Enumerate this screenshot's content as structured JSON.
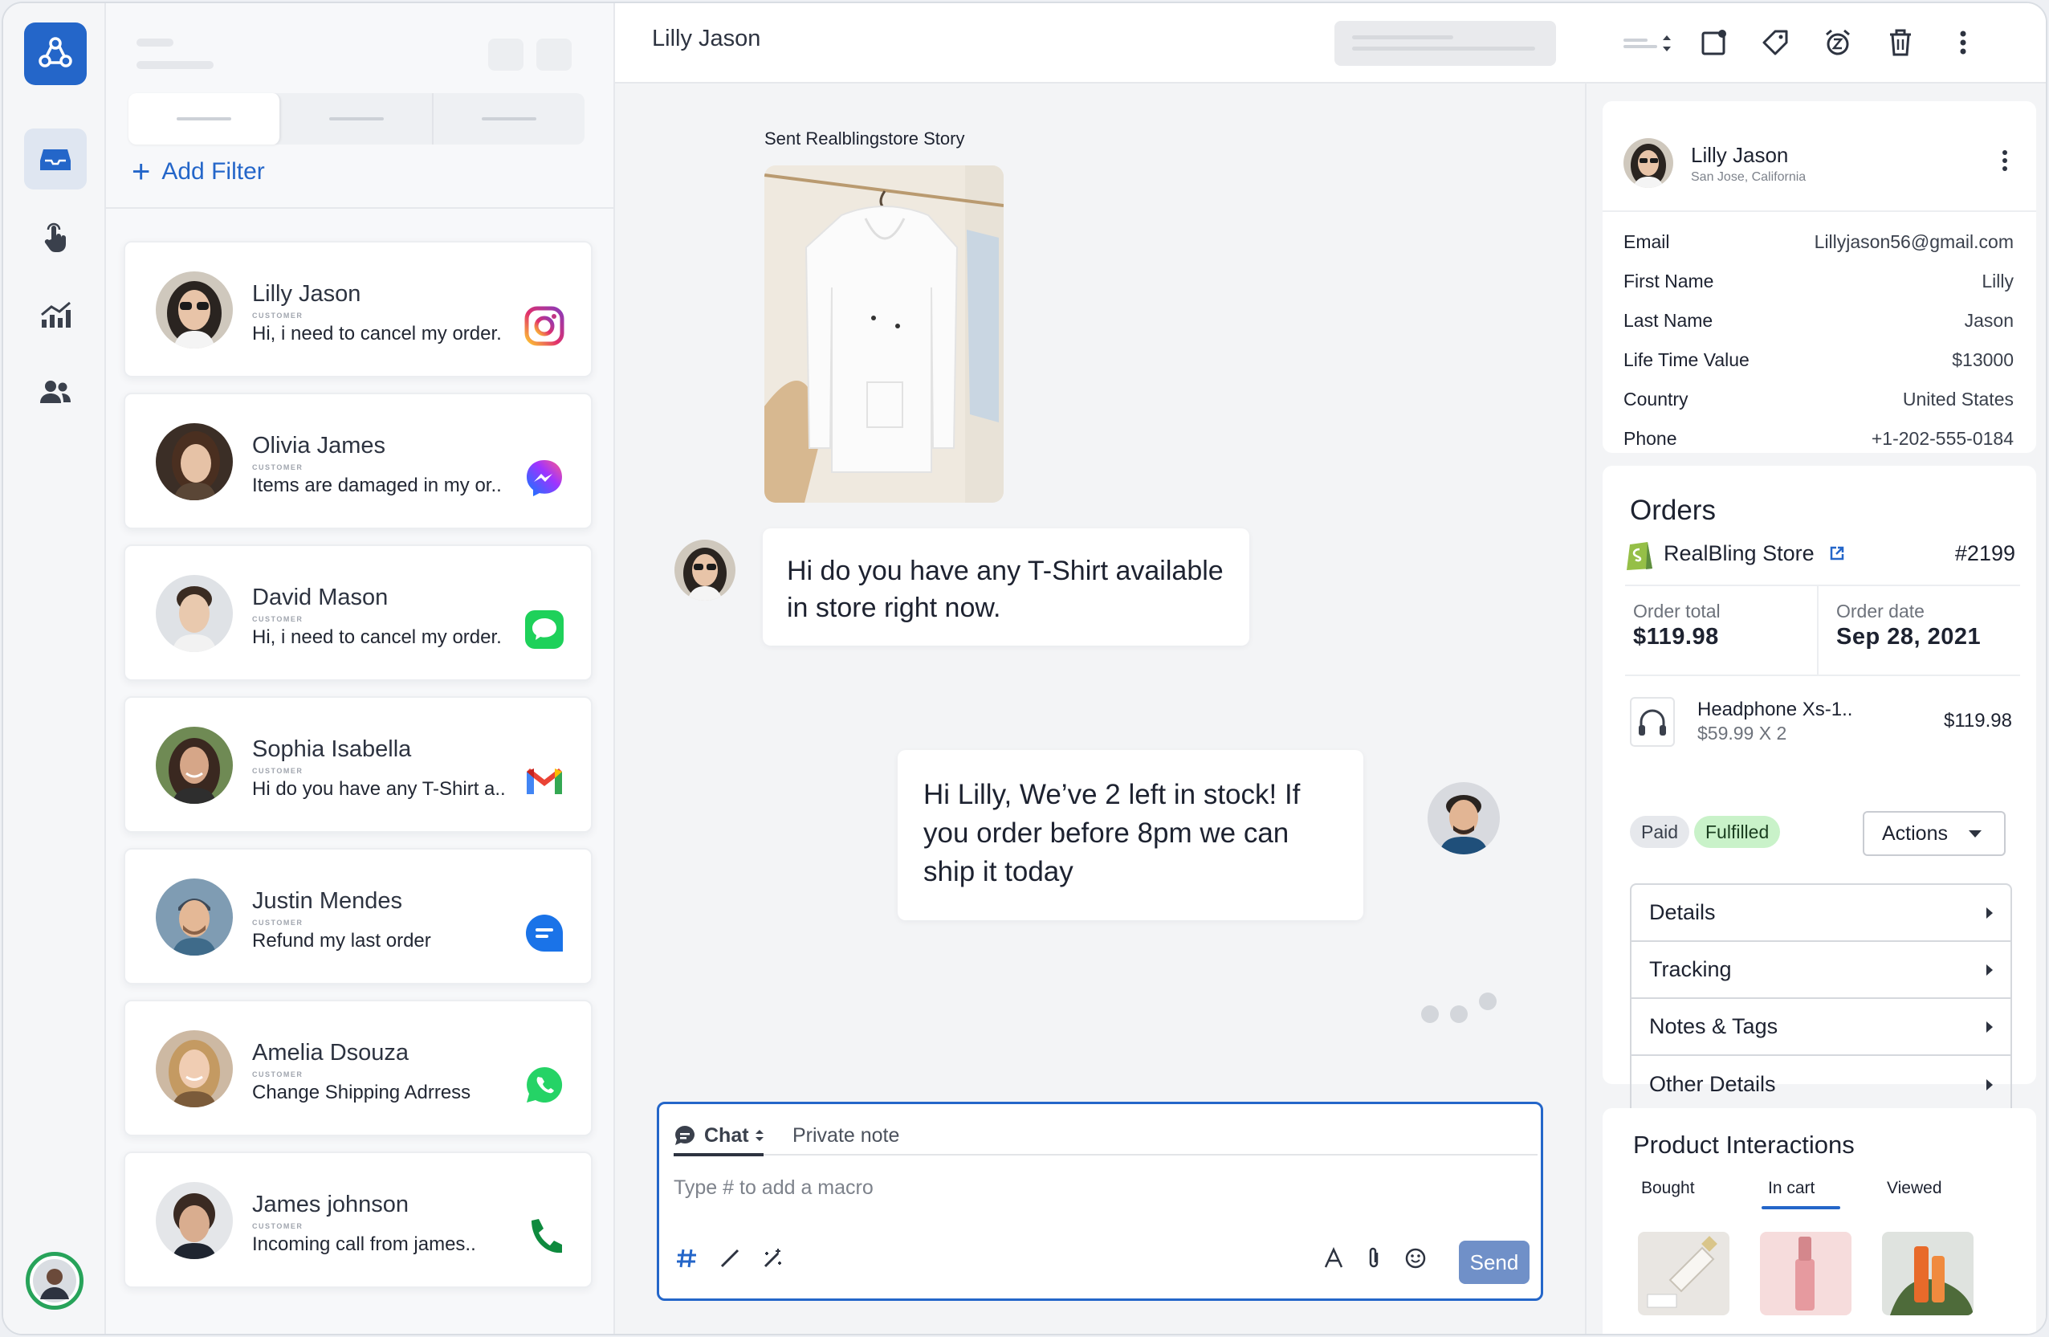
{
  "header": {
    "conversation_title": "Lilly Jason"
  },
  "filters": {
    "add_filter_label": "Add Filter"
  },
  "conversations": [
    {
      "name": "Lilly Jason",
      "role": "CUSTOMER",
      "preview": "Hi, i need to cancel my order.",
      "channel": "instagram-icon"
    },
    {
      "name": "Olivia James",
      "role": "CUSTOMER",
      "preview": "Items are damaged in my or..",
      "channel": "messenger-icon"
    },
    {
      "name": "David  Mason",
      "role": "CUSTOMER",
      "preview": "Hi, i need to cancel my order.",
      "channel": "sms-icon"
    },
    {
      "name": "Sophia Isabella",
      "role": "CUSTOMER",
      "preview": "Hi do you have any T-Shirt a..",
      "channel": "gmail-icon"
    },
    {
      "name": "Justin Mendes",
      "role": "CUSTOMER",
      "preview": "Refund my last order",
      "channel": "chat-icon"
    },
    {
      "name": "Amelia Dsouza",
      "role": "CUSTOMER",
      "preview": "Change Shipping Adrress",
      "channel": "whatsapp-icon"
    },
    {
      "name": "James johnson",
      "role": "CUSTOMER",
      "preview": "Incoming call from james..",
      "channel": "phone-icon"
    }
  ],
  "thread": {
    "story_label": "Sent Realblingstore Story",
    "customer_message": "Hi do you have any T-Shirt available in store right now.",
    "agent_message": "Hi Lilly, We’ve 2 left in stock! If you order before 8pm we can ship it today"
  },
  "composer": {
    "tab_chat": "Chat",
    "tab_private_note": "Private note",
    "placeholder": "Type # to add a macro",
    "send_label": "Send"
  },
  "profile": {
    "name": "Lilly Jason",
    "location": "San Jose, California",
    "fields": [
      {
        "key": "Email",
        "value": "Lillyjason56@gmail.com"
      },
      {
        "key": "First Name",
        "value": "Lilly"
      },
      {
        "key": "Last Name",
        "value": "Jason"
      },
      {
        "key": "Life Time Value",
        "value": "$13000"
      },
      {
        "key": "Country",
        "value": "United States"
      },
      {
        "key": "Phone",
        "value": "+1-202-555-0184"
      }
    ]
  },
  "orders": {
    "title": "Orders",
    "store_name": "RealBling Store",
    "order_number": "#2199",
    "total_label": "Order total",
    "total_value": "$119.98",
    "date_label": "Order date",
    "date_value": "Sep 28, 2021",
    "product_name": "Headphone Xs-1..",
    "product_qty": "$59.99 X 2",
    "product_price": "$119.98",
    "status_paid": "Paid",
    "status_fulfilled": "Fulfilled",
    "actions_label": "Actions",
    "sections": [
      "Details",
      "Tracking",
      "Notes & Tags",
      "Other Details"
    ]
  },
  "product_interactions": {
    "title": "Product Interactions",
    "tabs": [
      "Bought",
      "In cart",
      "Viewed"
    ],
    "active_tab": "In cart"
  },
  "colors": {
    "accent": "#2466c9",
    "send": "#7090c8",
    "online": "#27a35a",
    "fulfilled_bg": "#c9f2c9"
  }
}
